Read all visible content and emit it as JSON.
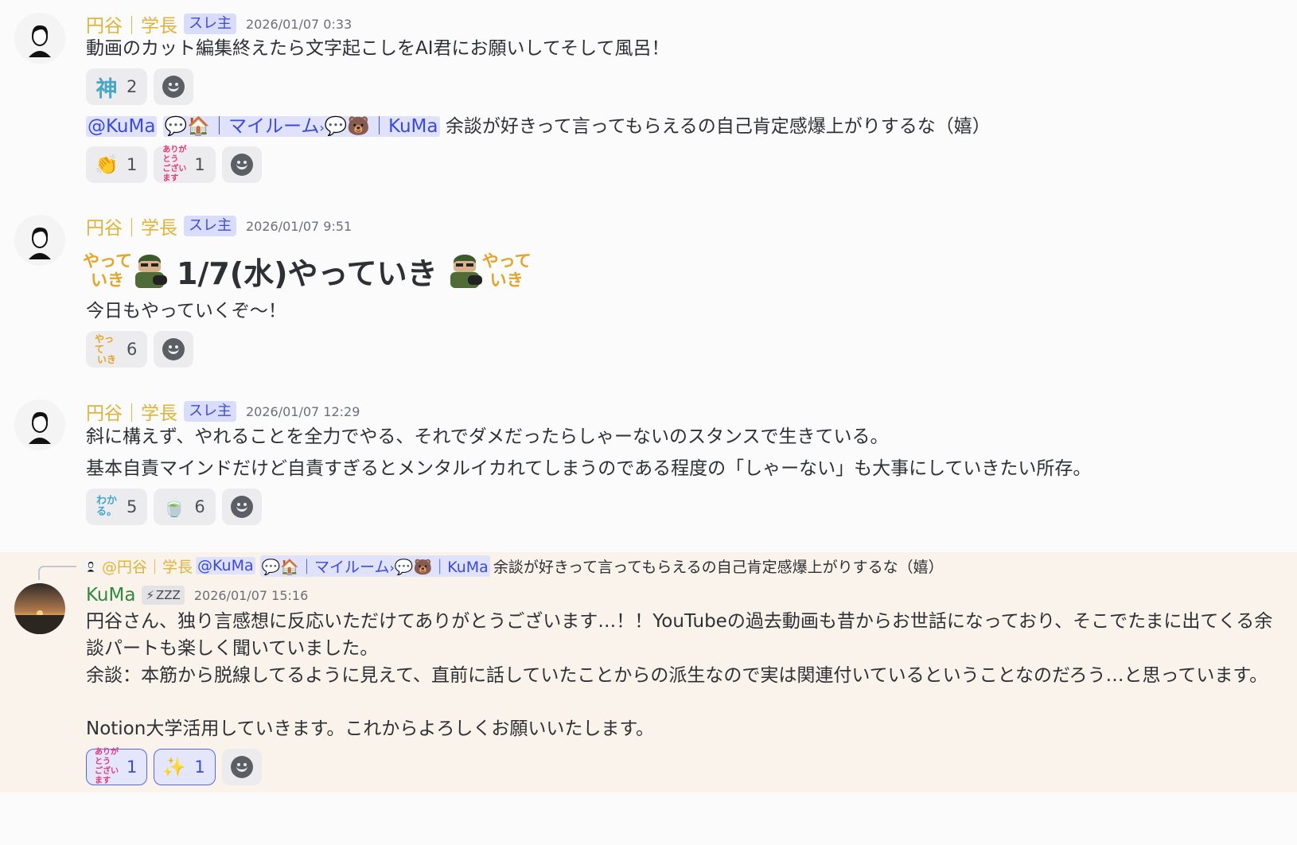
{
  "messages": [
    {
      "author": "円谷｜学長",
      "tag": "スレ主",
      "timestamp": "2026/01/07 0:33",
      "text": "動画のカット編集終えたら文字起こしをAI君にお願いしてそして風呂！",
      "reactions": [
        {
          "emoji": "神",
          "count": "2"
        }
      ],
      "followup": {
        "mention": "@KuMa",
        "channel_room": "マイルーム",
        "channel_user": "KuMa",
        "text": "余談が好きって言ってもらえるの自己肯定感爆上がりするな（嬉）",
        "reactions": [
          {
            "emoji": "clap-icon",
            "count": "1"
          },
          {
            "emoji": "arigato-gozaimasu-sticker",
            "count": "1",
            "label_lines": [
              "ありがとう",
              "ございます"
            ]
          }
        ]
      }
    },
    {
      "author": "円谷｜学長",
      "tag": "スレ主",
      "timestamp": "2026/01/07 9:51",
      "headline": "1/7(水)やっていき",
      "yatte_lines": [
        "やって",
        "いき"
      ],
      "text": "今日もやっていくぞ〜！",
      "reactions": [
        {
          "emoji": "yatteiki-sticker",
          "count": "6"
        }
      ]
    },
    {
      "author": "円谷｜学長",
      "tag": "スレ主",
      "timestamp": "2026/01/07 12:29",
      "lines": [
        "斜に構えず、やれることを全力でやる、それでダメだったらしゃーないのスタンスで生きている。",
        "基本自責マインドだけど自責すぎるとメンタルイカれてしまうのである程度の「しゃーない」も大事にしていきたい所存。"
      ],
      "reactions": [
        {
          "emoji": "wakaru-sticker",
          "count": "5",
          "label_lines": [
            "わか",
            "る。"
          ]
        },
        {
          "emoji": "green-tea-icon",
          "count": "6"
        }
      ]
    },
    {
      "reply_to": {
        "author": "@円谷｜学長",
        "mention": "@KuMa",
        "channel_room": "マイルーム",
        "channel_user": "KuMa",
        "text": "余談が好きって言ってもらえるの自己肯定感爆上がりするな（嬉）"
      },
      "author": "KuMa",
      "status": "ZZZ",
      "timestamp": "2026/01/07 15:16",
      "paragraphs": [
        "円谷さん、独り言感想に反応いただけてありがとうございます…！！YouTubeの過去動画も昔からお世話になっており、そこでたまに出てくる余談パートも楽しく聞いていました。",
        "余談：本筋から脱線してるように見えて、直前に話していたことからの派生なので実は関連付いているということなのだろう…と思っています。",
        "Notion大学活用していきます。これからよろしくお願いいたします。"
      ],
      "reactions": [
        {
          "emoji": "arigato-gozaimasu-sticker",
          "count": "1",
          "label_lines": [
            "ありがとう",
            "ございます"
          ],
          "selected": true
        },
        {
          "emoji": "sparkles-icon",
          "count": "1",
          "selected": true
        }
      ]
    }
  ],
  "colors": {
    "author": "#e0b33a",
    "tag_bg": "#d9dcfa",
    "mention": "#3b4bd6",
    "highlight_bg": "#faf3eb",
    "kuma_name": "#2f8a3c"
  }
}
